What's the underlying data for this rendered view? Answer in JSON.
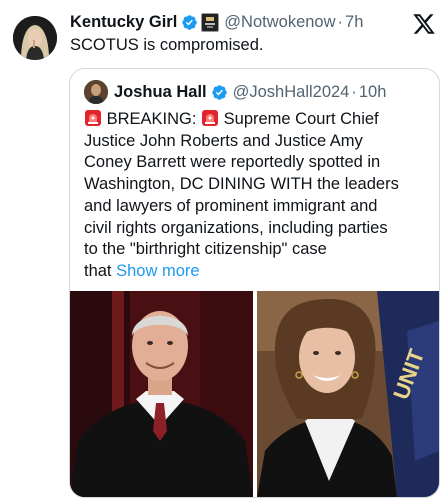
{
  "tweet": {
    "author_name": "Kentucky Girl",
    "handle": "@Notwokenow",
    "separator": "·",
    "time": "7h",
    "text": "SCOTUS is compromised."
  },
  "quote": {
    "author_name": "Joshua Hall",
    "handle": "@JoshHall2024",
    "separator": "·",
    "time": "10h",
    "lines": [
      "BREAKING:",
      "Supreme Court Chief",
      "Justice John Roberts and Justice Amy",
      "Coney Barrett were reportedly spotted in",
      "Washington, DC DINING WITH the leaders",
      "and lawyers of prominent immigrant and",
      "civil rights organizations, including parties",
      "to the \"birthright citizenship\" case",
      "that"
    ],
    "show_more": "Show more"
  },
  "photos": {
    "flag_text": "UNIT"
  },
  "icons": {
    "verified": "verified-badge-icon",
    "affiliation": "affiliation-badge-icon",
    "x_logo": "x-logo-icon",
    "siren": "police-light-emoji-icon"
  },
  "colors": {
    "link": "#1d9bf0",
    "muted": "#536471",
    "verified": "#1d9bf0",
    "border": "#cfd9de"
  }
}
